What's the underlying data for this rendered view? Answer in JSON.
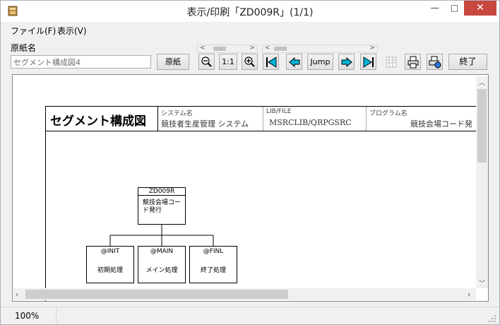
{
  "window": {
    "title": "表示/印刷「ZD009R」(1/1)"
  },
  "menu": {
    "file": "ファイル(F)",
    "view": "表示(V)"
  },
  "form": {
    "paper_label": "原紙名",
    "paper_value": "セグメント構成図4"
  },
  "toolbar": {
    "paper_button": "原紙",
    "zoom_reset": "1:1",
    "jump": "Jump",
    "exit": "終了"
  },
  "document": {
    "header_title": "セグメント構成図",
    "system_label": "システム名",
    "system_value": "競技者生産管理 システム",
    "lib_label": "LIB/FILE",
    "lib_value": "MSRCLIB/QRPGSRC",
    "program_label": "プログラム名",
    "program_value": "競技会場コード発",
    "root": {
      "id": "ZD009R",
      "name": "競技会場コード発行"
    },
    "children": [
      {
        "id": "@INIT",
        "name": "初期処理"
      },
      {
        "id": "@MAIN",
        "name": "メイン処理"
      },
      {
        "id": "@FINL",
        "name": "終了処理"
      }
    ]
  },
  "status": {
    "zoom": "100%"
  }
}
